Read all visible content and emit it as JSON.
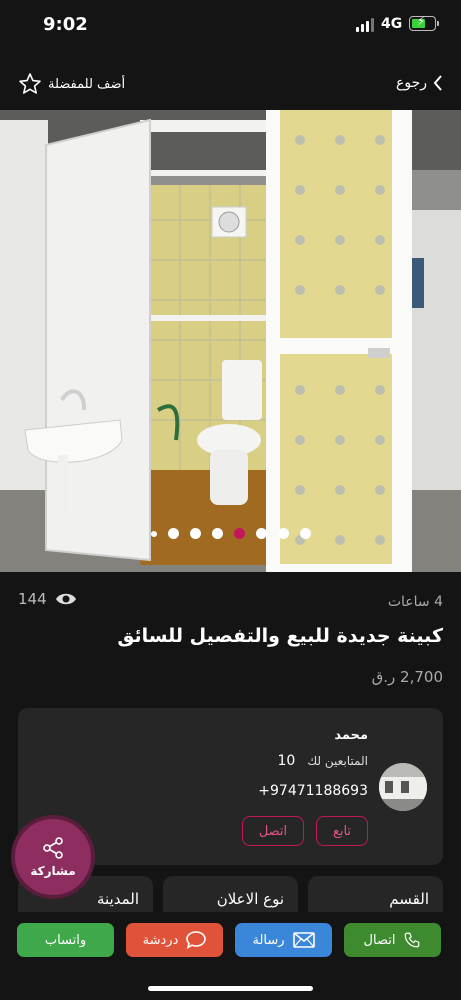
{
  "status_bar": {
    "time": "9:02",
    "network": "4G"
  },
  "nav": {
    "back_label": "رجوع",
    "favorite_label": "أضف للمفضلة"
  },
  "carousel": {
    "total": 8,
    "active_index": 4
  },
  "ad": {
    "time_ago": "4 ساعات",
    "views": "144",
    "title": "كبينة جديدة للبيع والتفصيل للسائق",
    "price": "2,700 ر.ق"
  },
  "seller": {
    "name": "محمد",
    "followers_label": "المتابعين لك",
    "followers_count": "10",
    "phone": "+97471188693",
    "follow_label": "تابع",
    "contact_label": "اتصل"
  },
  "chips": [
    {
      "label": "القسم"
    },
    {
      "label": "نوع الاعلان"
    },
    {
      "label": "المدينة"
    }
  ],
  "share": {
    "label": "مشاركة"
  },
  "actions": {
    "call": {
      "label": "اتصال",
      "color": "#3d8a2f"
    },
    "message": {
      "label": "رسالة",
      "color": "#3a86d8"
    },
    "chat": {
      "label": "دردشة",
      "color": "#e0533a"
    },
    "whatsapp": {
      "label": "واتساب",
      "color": "#3ea84a"
    }
  },
  "colors": {
    "accent": "#c2185b",
    "background": "#141414",
    "card": "#262626"
  }
}
